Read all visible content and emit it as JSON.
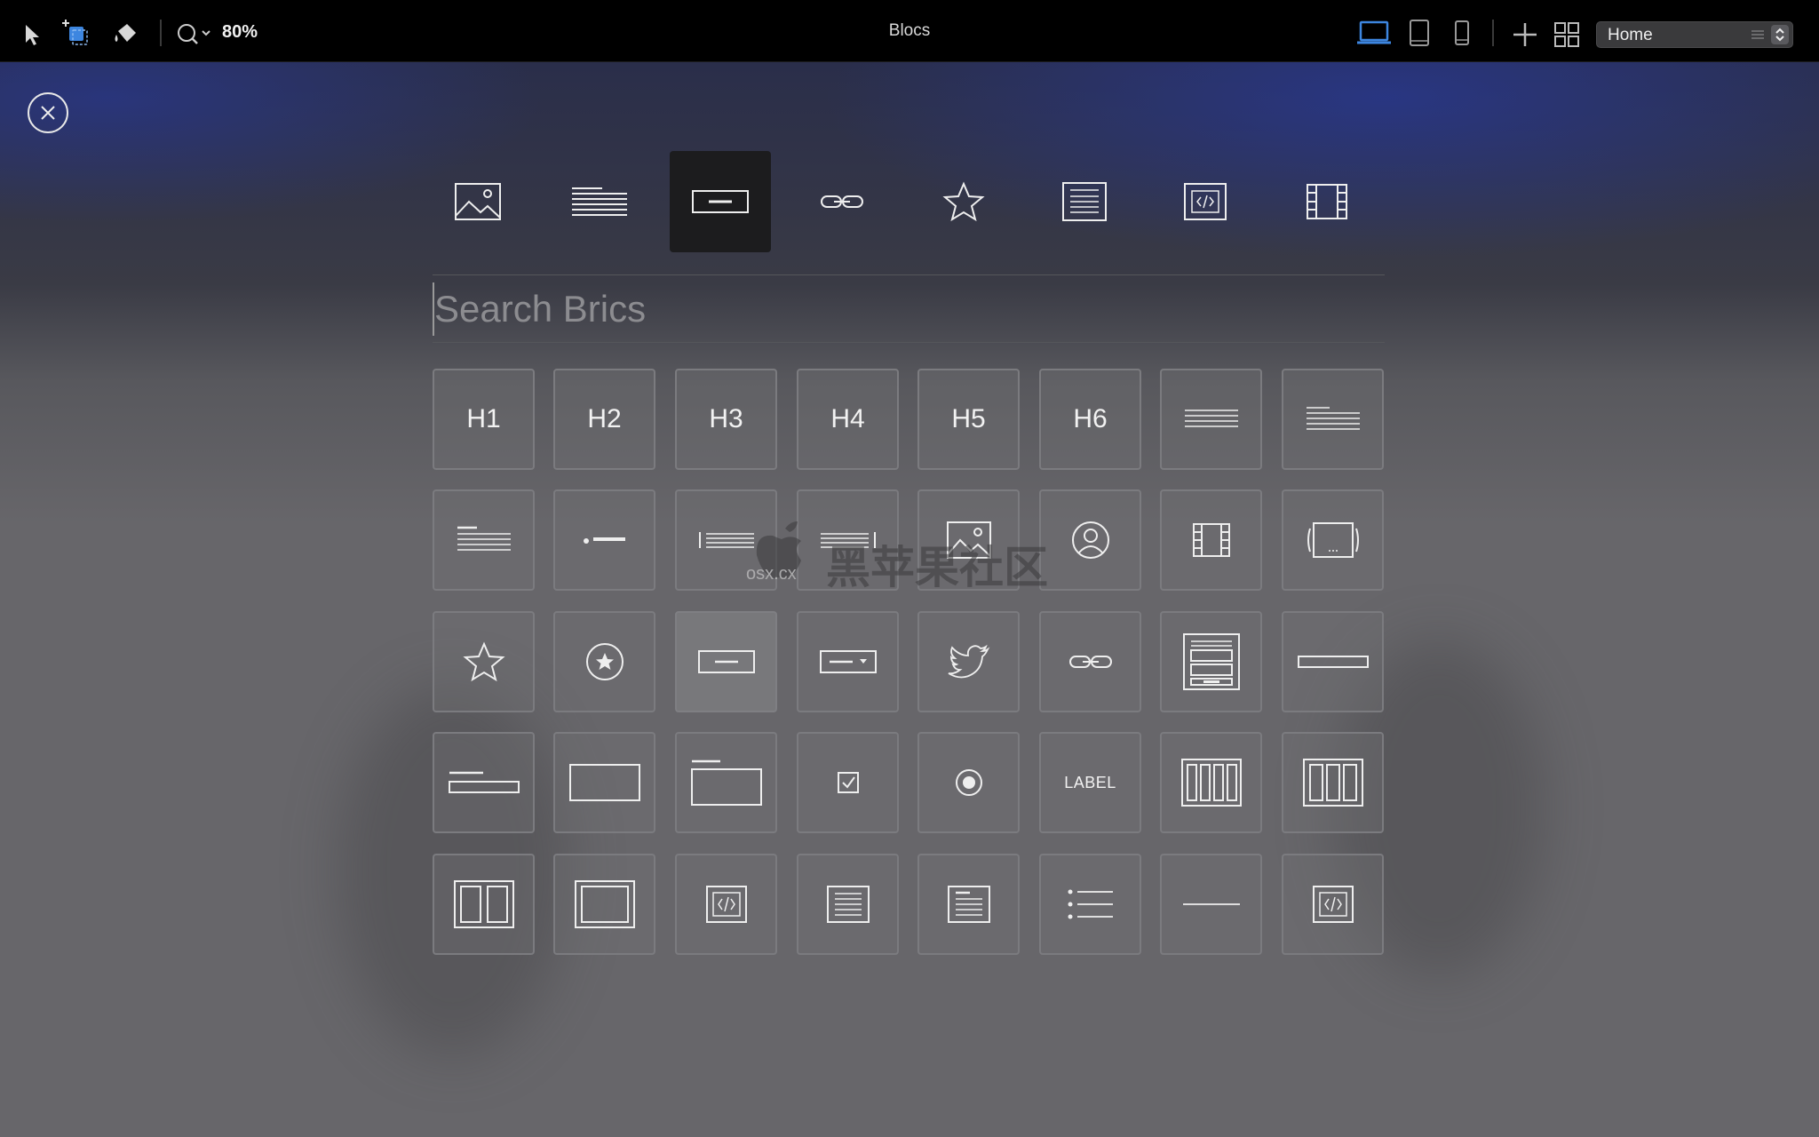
{
  "toolbar": {
    "title": "Blocs",
    "zoom": "80%",
    "page_select": "Home"
  },
  "categories": [
    {
      "name": "image"
    },
    {
      "name": "text"
    },
    {
      "name": "button",
      "active": true
    },
    {
      "name": "link"
    },
    {
      "name": "icon"
    },
    {
      "name": "form"
    },
    {
      "name": "code"
    },
    {
      "name": "media"
    }
  ],
  "search": {
    "placeholder": "Search Brics"
  },
  "bricks": {
    "h1": "H1",
    "h2": "H2",
    "h3": "H3",
    "h4": "H4",
    "h5": "H5",
    "h6": "H6",
    "label": "LABEL"
  },
  "watermark": {
    "text": "黑苹果社区",
    "url": "osx.cx"
  }
}
